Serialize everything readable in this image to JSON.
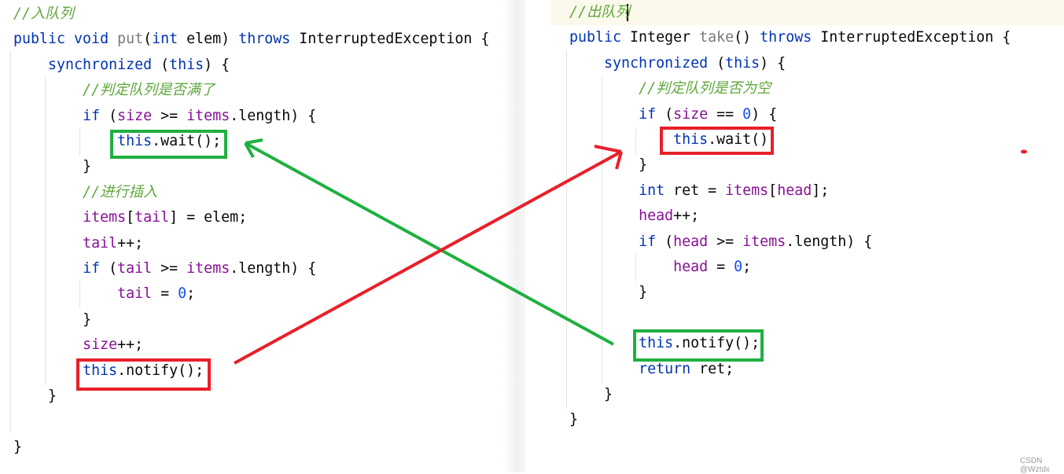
{
  "left_panel": {
    "lines": [
      [
        {
          "t": "//入队列",
          "c": "cm"
        }
      ],
      [
        {
          "t": "public ",
          "c": "kw"
        },
        {
          "t": "void ",
          "c": "kw"
        },
        {
          "t": "put",
          "c": "fn"
        },
        {
          "t": "(",
          "c": "pl"
        },
        {
          "t": "int ",
          "c": "kw"
        },
        {
          "t": "elem) ",
          "c": "pl"
        },
        {
          "t": "throws ",
          "c": "kw"
        },
        {
          "t": "InterruptedException {",
          "c": "pl"
        }
      ],
      [
        {
          "t": "    "
        },
        {
          "t": "synchronized ",
          "c": "kw"
        },
        {
          "t": "(",
          "c": "pl"
        },
        {
          "t": "this",
          "c": "kw"
        },
        {
          "t": ") {",
          "c": "pl"
        }
      ],
      [
        {
          "t": "        "
        },
        {
          "t": "//判定队列是否满了",
          "c": "cm"
        }
      ],
      [
        {
          "t": "        "
        },
        {
          "t": "if ",
          "c": "kw"
        },
        {
          "t": "(",
          "c": "pl"
        },
        {
          "t": "size ",
          "c": "fld"
        },
        {
          "t": ">= ",
          "c": "pl"
        },
        {
          "t": "items",
          "c": "fld"
        },
        {
          "t": ".length) {",
          "c": "pl"
        }
      ],
      [
        {
          "t": "            "
        },
        {
          "t": "this",
          "c": "kw"
        },
        {
          "t": ".wait();",
          "c": "pl"
        }
      ],
      [
        {
          "t": "        "
        },
        {
          "t": "}",
          "c": "pl"
        }
      ],
      [
        {
          "t": "        "
        },
        {
          "t": "//进行插入",
          "c": "cm"
        }
      ],
      [
        {
          "t": "        "
        },
        {
          "t": "items",
          "c": "fld"
        },
        {
          "t": "[",
          "c": "pl"
        },
        {
          "t": "tail",
          "c": "fld"
        },
        {
          "t": "] = elem;",
          "c": "pl"
        }
      ],
      [
        {
          "t": "        "
        },
        {
          "t": "tail",
          "c": "fld"
        },
        {
          "t": "++;",
          "c": "pl"
        }
      ],
      [
        {
          "t": "        "
        },
        {
          "t": "if ",
          "c": "kw"
        },
        {
          "t": "(",
          "c": "pl"
        },
        {
          "t": "tail ",
          "c": "fld"
        },
        {
          "t": ">= ",
          "c": "pl"
        },
        {
          "t": "items",
          "c": "fld"
        },
        {
          "t": ".length) {",
          "c": "pl"
        }
      ],
      [
        {
          "t": "            "
        },
        {
          "t": "tail ",
          "c": "fld"
        },
        {
          "t": "= ",
          "c": "pl"
        },
        {
          "t": "0",
          "c": "num"
        },
        {
          "t": ";",
          "c": "pl"
        }
      ],
      [
        {
          "t": "        "
        },
        {
          "t": "}",
          "c": "pl"
        }
      ],
      [
        {
          "t": "        "
        },
        {
          "t": "size",
          "c": "fld"
        },
        {
          "t": "++;",
          "c": "pl"
        }
      ],
      [
        {
          "t": "        "
        },
        {
          "t": "this",
          "c": "kw"
        },
        {
          "t": ".notify();",
          "c": "pl"
        }
      ],
      [
        {
          "t": "    "
        },
        {
          "t": "}",
          "c": "pl"
        }
      ],
      [],
      [
        {
          "t": "}",
          "c": "pl"
        }
      ]
    ]
  },
  "right_panel": {
    "lines": [
      [
        {
          "t": "//出队列",
          "c": "cm"
        }
      ],
      [
        {
          "t": "public ",
          "c": "kw"
        },
        {
          "t": "Integer ",
          "c": "pl"
        },
        {
          "t": "take",
          "c": "fn"
        },
        {
          "t": "() ",
          "c": "pl"
        },
        {
          "t": "throws ",
          "c": "kw"
        },
        {
          "t": "InterruptedException {",
          "c": "pl"
        }
      ],
      [
        {
          "t": "    "
        },
        {
          "t": "synchronized ",
          "c": "kw"
        },
        {
          "t": "(",
          "c": "pl"
        },
        {
          "t": "this",
          "c": "kw"
        },
        {
          "t": ") {",
          "c": "pl"
        }
      ],
      [
        {
          "t": "        "
        },
        {
          "t": "//判定队列是否为空",
          "c": "cm"
        }
      ],
      [
        {
          "t": "        "
        },
        {
          "t": "if ",
          "c": "kw"
        },
        {
          "t": "(",
          "c": "pl"
        },
        {
          "t": "size ",
          "c": "fld"
        },
        {
          "t": "== ",
          "c": "pl"
        },
        {
          "t": "0",
          "c": "num"
        },
        {
          "t": ") {",
          "c": "pl"
        }
      ],
      [
        {
          "t": "            "
        },
        {
          "t": "this",
          "c": "kw"
        },
        {
          "t": ".wait();",
          "c": "pl"
        }
      ],
      [
        {
          "t": "        "
        },
        {
          "t": "}",
          "c": "pl"
        }
      ],
      [
        {
          "t": "        "
        },
        {
          "t": "int ",
          "c": "kw"
        },
        {
          "t": "ret = ",
          "c": "pl"
        },
        {
          "t": "items",
          "c": "fld"
        },
        {
          "t": "[",
          "c": "pl"
        },
        {
          "t": "head",
          "c": "fld"
        },
        {
          "t": "];",
          "c": "pl"
        }
      ],
      [
        {
          "t": "        "
        },
        {
          "t": "head",
          "c": "fld"
        },
        {
          "t": "++;",
          "c": "pl"
        }
      ],
      [
        {
          "t": "        "
        },
        {
          "t": "if ",
          "c": "kw"
        },
        {
          "t": "(",
          "c": "pl"
        },
        {
          "t": "head ",
          "c": "fld"
        },
        {
          "t": ">= ",
          "c": "pl"
        },
        {
          "t": "items",
          "c": "fld"
        },
        {
          "t": ".length) {",
          "c": "pl"
        }
      ],
      [
        {
          "t": "            "
        },
        {
          "t": "head ",
          "c": "fld"
        },
        {
          "t": "= ",
          "c": "pl"
        },
        {
          "t": "0",
          "c": "num"
        },
        {
          "t": ";",
          "c": "pl"
        }
      ],
      [
        {
          "t": "        "
        },
        {
          "t": "}",
          "c": "pl"
        }
      ],
      [],
      [
        {
          "t": "        "
        },
        {
          "t": "this",
          "c": "kw"
        },
        {
          "t": ".notify();",
          "c": "pl"
        }
      ],
      [
        {
          "t": "        "
        },
        {
          "t": "return ",
          "c": "kw"
        },
        {
          "t": "ret;",
          "c": "pl"
        }
      ],
      [
        {
          "t": "    "
        },
        {
          "t": "}",
          "c": "pl"
        }
      ],
      [
        {
          "t": "}",
          "c": "pl"
        }
      ]
    ]
  },
  "annotation_colors": {
    "green": "#1fb040",
    "red": "#e8202a"
  },
  "watermark": "CSDN @Wztdx"
}
